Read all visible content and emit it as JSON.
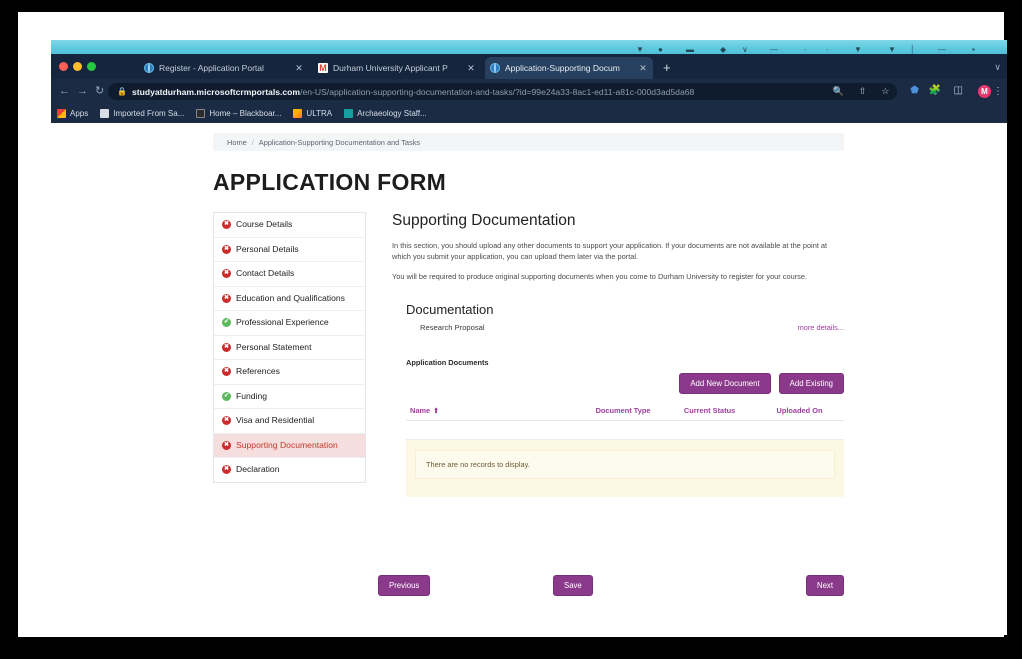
{
  "browser": {
    "tabs": [
      {
        "title": "Register  - Application Portal",
        "favicon": "globe-icon",
        "active": false
      },
      {
        "title": "Durham University Applicant P",
        "favicon": "gmail-icon",
        "active": false
      },
      {
        "title": "Application-Supporting Docum",
        "favicon": "globe-icon",
        "active": true
      }
    ],
    "new_tab_label": "+",
    "window_chevron": "∨",
    "nav": {
      "back": "←",
      "forward": "→",
      "reload": "↻"
    },
    "omnibox": {
      "lock_icon": "🔒",
      "url_strong": "studyatdurham.microsoftcrmportals.com",
      "url_dim": "/en-US/application-supporting-documentation-and-tasks/?id=99e24a33-8ac1-ed11-a81c-000d3ad5da68"
    },
    "omni_actions": [
      "🔍",
      "⇧",
      "☆"
    ],
    "extensions": [
      "⬟",
      "🧩",
      "◫"
    ],
    "avatar_initial": "M",
    "kebab": "⋮",
    "bookmarks": [
      {
        "label": "Apps",
        "icon": "apps-grid-icon"
      },
      {
        "label": "Imported From Sa...",
        "icon": "folder-icon"
      },
      {
        "label": "Home – Blackboar...",
        "icon": "blackboard-icon"
      },
      {
        "label": "ULTRA",
        "icon": "ultra-icon"
      },
      {
        "label": "Archaeology Staff...",
        "icon": "teal-dot-icon"
      }
    ]
  },
  "page": {
    "breadcrumb": {
      "home": "Home",
      "separator": "/",
      "current": "Application-Supporting Documentation and Tasks"
    },
    "title": "APPLICATION FORM",
    "sidebar": {
      "items": [
        {
          "label": "Course Details",
          "status": "incomplete",
          "active": false
        },
        {
          "label": "Personal Details",
          "status": "incomplete",
          "active": false
        },
        {
          "label": "Contact Details",
          "status": "incomplete",
          "active": false
        },
        {
          "label": "Education and Qualifications",
          "status": "incomplete",
          "active": false
        },
        {
          "label": "Professional Experience",
          "status": "complete",
          "active": false
        },
        {
          "label": "Personal Statement",
          "status": "incomplete",
          "active": false
        },
        {
          "label": "References",
          "status": "incomplete",
          "active": false
        },
        {
          "label": "Funding",
          "status": "complete",
          "active": false
        },
        {
          "label": "Visa and Residential",
          "status": "incomplete",
          "active": false
        },
        {
          "label": "Supporting Documentation",
          "status": "incomplete",
          "active": true
        },
        {
          "label": "Declaration",
          "status": "incomplete",
          "active": false
        }
      ]
    },
    "main": {
      "heading": "Supporting Documentation",
      "paragraph_1": "In this section, you should upload any other documents to support your application. If your documents are not available at the point at which you submit your application, you can upload them later via the portal.",
      "paragraph_2": "You will be required to produce original supporting documents when you come to Durham University to register for your course.",
      "documentation": {
        "heading": "Documentation",
        "item_label": "Research Proposal",
        "more_details_link": "more details..."
      },
      "grid": {
        "section_label": "Application Documents",
        "add_new_button": "Add New Document",
        "add_existing_button": "Add Existing",
        "columns": [
          {
            "label": "Name",
            "sort_arrow": "⬆"
          },
          {
            "label": "Document Type",
            "sort_arrow": ""
          },
          {
            "label": "Current Status",
            "sort_arrow": ""
          },
          {
            "label": "Uploaded On",
            "sort_arrow": ""
          }
        ],
        "rows": [],
        "empty_message": "There are no records to display."
      }
    },
    "footer": {
      "previous_button": "Previous",
      "save_button": "Save",
      "next_button": "Next"
    },
    "colors": {
      "brand_purple": "#8b3a8b",
      "link_purple": "#a03fa0",
      "status_incomplete": "#cc2b2b",
      "status_complete": "#5cb85c",
      "active_nav_bg": "#f7dede",
      "empty_panel_bg": "#fdf8e3"
    }
  }
}
